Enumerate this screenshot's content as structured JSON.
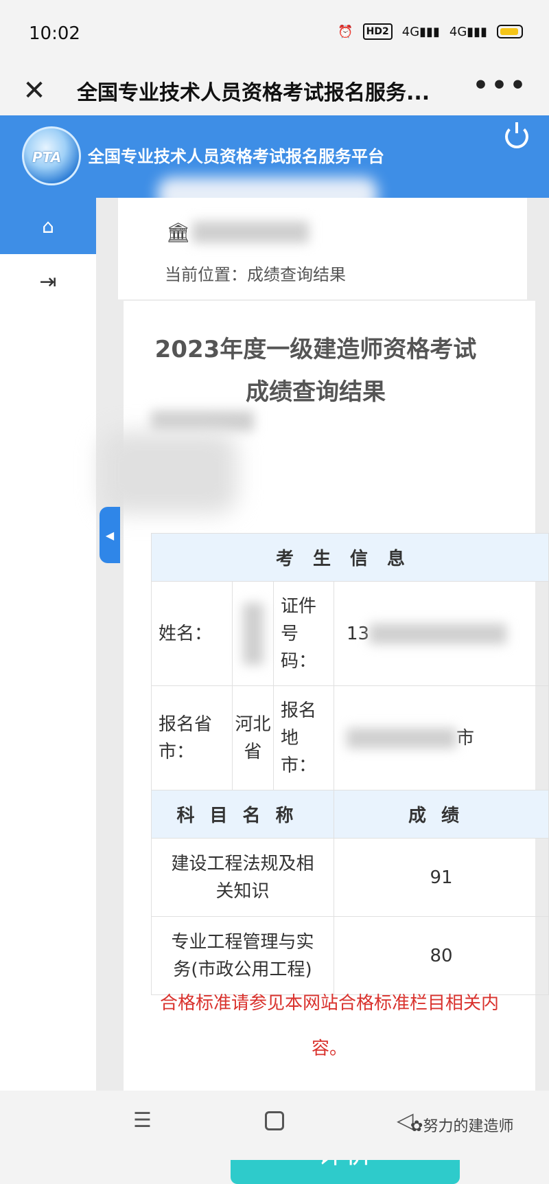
{
  "status_bar": {
    "time": "10:02",
    "hd_badge": "HD2",
    "net1": "4G",
    "net2": "4G"
  },
  "browser": {
    "title": "全国专业技术人员资格考试报名服务...",
    "more": "•••",
    "close": "✕"
  },
  "site": {
    "logo_text": "PTA",
    "name": "全国专业技术人员资格考试报名服务平台"
  },
  "breadcrumb": {
    "location": "当前位置：成绩查询结果"
  },
  "result": {
    "title_line1": "2023年度一级建造师资格考试",
    "title_line2": "成绩查询结果"
  },
  "table": {
    "section_header": "考生信息",
    "name_label": "姓名：",
    "id_label": "证件号码：",
    "id_value_prefix": "13",
    "province_label": "报名省市：",
    "province_value": "河北省",
    "city_label": "报名地市：",
    "city_value_suffix": "市",
    "subject_header": "科目名称",
    "score_header": "成绩",
    "rows": [
      {
        "subject": "建设工程法规及相关知识",
        "score": "91"
      },
      {
        "subject": "专业工程管理与实务(市政公用工程)",
        "score": "80"
      }
    ]
  },
  "notice": "合格标准请参见本网站合格标准栏目相关内容。",
  "buttons": {
    "evaluate": "评价"
  },
  "watermark": "努力的建造师",
  "colors": {
    "header_blue": "#3e8ee6",
    "button_teal": "#2ecbcb",
    "notice_red": "#d9322d"
  }
}
